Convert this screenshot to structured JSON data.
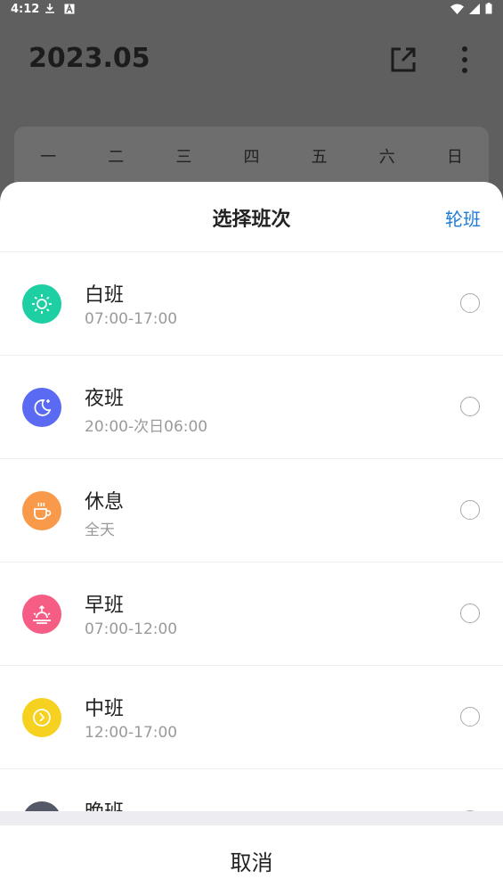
{
  "status_bar": {
    "time": "4:12",
    "icons_left": [
      "download-icon",
      "font-icon"
    ],
    "icons_right": [
      "wifi-icon",
      "signal-icon",
      "battery-icon"
    ]
  },
  "header": {
    "month": "2023.05",
    "export_icon": "export-icon",
    "more_icon": "more-vertical-icon"
  },
  "weekdays": [
    "一",
    "二",
    "三",
    "四",
    "五",
    "六",
    "日"
  ],
  "sheet": {
    "title": "选择班次",
    "rotate_label": "轮班",
    "shifts": [
      {
        "name": "白班",
        "time": "07:00-17:00",
        "icon": "sun-icon",
        "color": "#1fcfa4"
      },
      {
        "name": "夜班",
        "time": "20:00-次日06:00",
        "icon": "moon-icon",
        "color": "#5b6af2"
      },
      {
        "name": "休息",
        "time": "全天",
        "icon": "coffee-icon",
        "color": "#f99a4b"
      },
      {
        "name": "早班",
        "time": "07:00-12:00",
        "icon": "sunrise-icon",
        "color": "#f55d84"
      },
      {
        "name": "中班",
        "time": "12:00-17:00",
        "icon": "clock-icon",
        "color": "#f6d11f"
      },
      {
        "name": "晚班",
        "time": "",
        "icon": "evening-icon",
        "color": "#555866"
      }
    ],
    "cancel_label": "取消"
  }
}
